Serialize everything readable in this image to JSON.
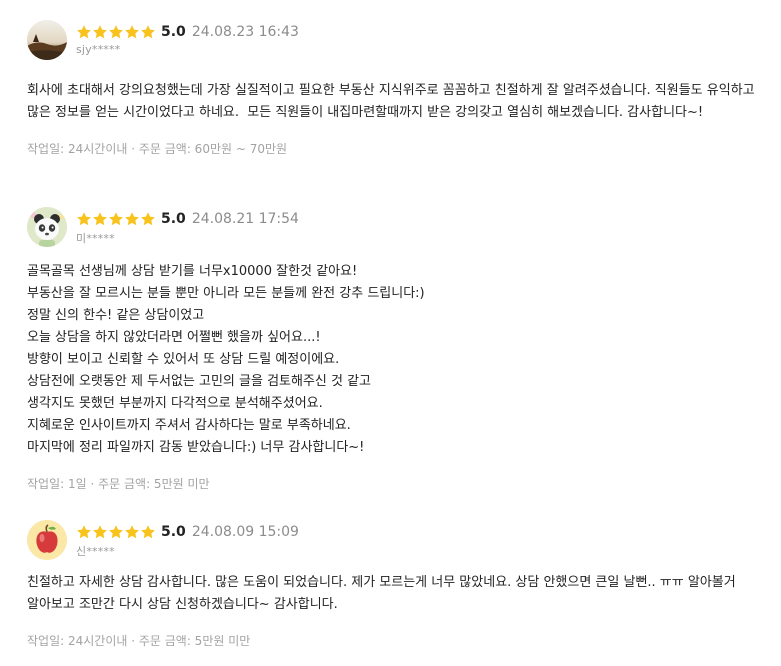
{
  "reviews": [
    {
      "rating": "5.0",
      "date": "24.08.23 16:43",
      "user": "sjy*****",
      "avatar": "sunset-landscape-avatar",
      "text": "회사에 초대해서 강의요청했는데 가장 실질적이고 필요한 부동산 지식위주로 꼼꼼하고 친절하게 잘 알려주셨습니다. 직원들도 유익하고 많은 정보를 얻는 시간이었다고 하네요.  모든 직원들이 내집마련할때까지 받은 강의갖고 열심히 해보겠습니다. 감사합니다~!",
      "meta": "작업일: 24시간이내 · 주문 금액: 60만원 ~ 70만원"
    },
    {
      "rating": "5.0",
      "date": "24.08.21 17:54",
      "user": "미*****",
      "avatar": "panda-character-avatar",
      "text": "골목골목 선생님께 상담 받기를 너무x10000 잘한것 같아요!\n부동산을 잘 모르시는 분들 뿐만 아니라 모든 분들께 완전 강추 드립니다:)\n정말 신의 한수! 같은 상담이었고\n오늘 상담을 하지 않았더라면 어쩔뻔 했을까 싶어요...!\n방향이 보이고 신뢰할 수 있어서 또 상담 드릴 예정이에요.\n상담전에 오랫동안 제 두서없는 고민의 글을 검토해주신 것 같고\n생각지도 못했던 부분까지 다각적으로 분석해주셨어요.\n지혜로운 인사이트까지 주셔서 감사하다는 말로 부족하네요.\n마지막에 정리 파일까지 감동 받았습니다:) 너무 감사합니다~!",
      "meta": "작업일: 1일 · 주문 금액: 5만원 미만"
    },
    {
      "rating": "5.0",
      "date": "24.08.09 15:09",
      "user": "신*****",
      "avatar": "apple-avatar",
      "text": "친절하고 자세한 상담 감사합니다. 많은 도움이 되었습니다. 제가 모르는게 너무 많았네요. 상담 안했으면 큰일 날뻔.. ㅠㅠ 알아볼거 알아보고 조만간 다시 상담 신청하겠습니다~ 감사합니다.",
      "meta": "작업일: 24시간이내 · 주문 금액: 5만원 미만"
    }
  ],
  "colors": {
    "star": "#F7C31C",
    "date": "#8C8C8C",
    "meta": "#A3A3A3"
  },
  "icons": {
    "star": "star-icon"
  }
}
